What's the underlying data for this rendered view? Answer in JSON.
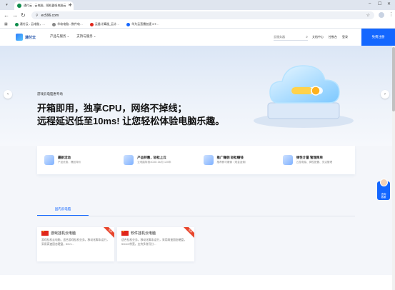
{
  "browser": {
    "tab_title": "通付云 - 云电脑，随机器吸电脑云...",
    "url": "ec596.com",
    "bookmarks": [
      "通付云 - 云电脑，…",
      "华软电脑 - 数件电…",
      "云备计算器_云计…",
      "华为云直播加速 GT…"
    ]
  },
  "site": {
    "logo_text": "通付云",
    "nav": [
      "产品与服务",
      "支持与服务"
    ],
    "search_placeholder": "云服务器",
    "header_links": [
      "文档中心",
      "控制台",
      "登录"
    ],
    "signup_label": "免费注册"
  },
  "hero": {
    "eyebrow": "游戏云电脑惠专场",
    "headline_1": "开箱即用，独享CPU，网络不掉线；",
    "headline_2": "远程延迟低至10ms! 让您轻松体验电脑乐趣。"
  },
  "features": [
    {
      "title": "最新活动",
      "sub": "产品优惠、爆品特价"
    },
    {
      "title": "产品特惠，轻松上云",
      "sub": "云电脑特惠4C8G 2k/月 120年"
    },
    {
      "title": "推广赚佣 轻松赚钱",
      "sub": "推荐即可赚佣（现金返佣）"
    },
    {
      "title": "弹性计量 管理简单",
      "sub": "云挂电脑、弹性配置、灵活管理"
    }
  ],
  "section_tab": "国内云电脑",
  "cards": [
    {
      "title": "游戏挂机云电脑",
      "ribbon": "热卖",
      "desc": "游戏挂机云电脑，适合游戏挂机业务，移动化脚本运行，采用高速固态硬盘，5G/1..."
    },
    {
      "title": "软件挂机云电脑",
      "ribbon": "热卖",
      "desc": "适合挂机业务，移动化脚本运行，采用高速固态硬盘，5G/1G带宽，支持多账号分..."
    }
  ],
  "side_widget": [
    "咨询",
    "客服"
  ],
  "colors": {
    "brand": "#1467ff",
    "accent_red": "#e0261b"
  }
}
